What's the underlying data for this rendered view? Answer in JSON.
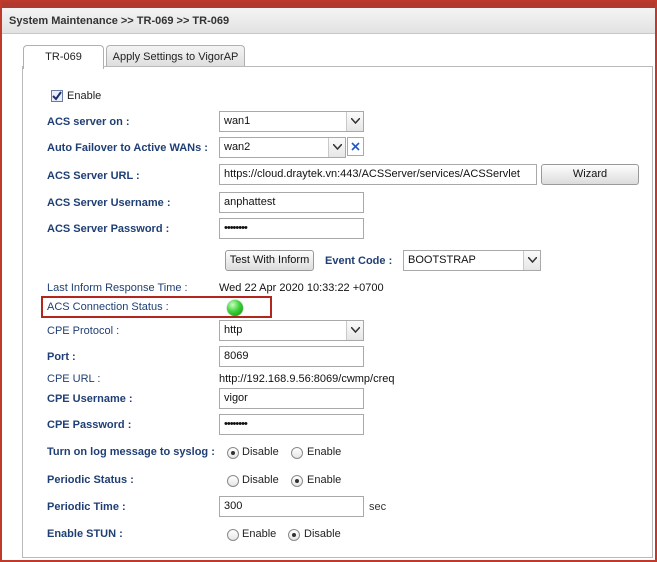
{
  "header": {
    "breadcrumb": "System Maintenance >> TR-069 >> TR-069"
  },
  "tabs": [
    "TR-069",
    "Apply Settings to VigorAP"
  ],
  "enable": {
    "label": "Enable",
    "checked": true
  },
  "acs_server_on": {
    "label": "ACS server on :",
    "value": "wan1"
  },
  "auto_failover": {
    "label": "Auto Failover to Active WANs :",
    "value": "wan2"
  },
  "acs_url": {
    "label": "ACS Server URL :",
    "value": "https://cloud.draytek.vn:443/ACSServer/services/ACSServlet",
    "wizard": "Wizard"
  },
  "acs_username": {
    "label": "ACS Server Username :",
    "value": "anphattest"
  },
  "acs_password": {
    "label": "ACS Server Password :",
    "value": "••••••••"
  },
  "test_inform": {
    "label": "Test With Inform"
  },
  "event_code": {
    "label": "Event Code :",
    "value": "BOOTSTRAP"
  },
  "last_inform": {
    "label": "Last Inform Response Time :",
    "value": "Wed 22 Apr 2020 10:33:22 +0700"
  },
  "acs_conn_status": {
    "label": "ACS Connection Status :",
    "status_color": "#3ed23a"
  },
  "cpe_protocol": {
    "label": "CPE Protocol :",
    "value": "http"
  },
  "port": {
    "label": "Port :",
    "value": "8069"
  },
  "cpe_url": {
    "label": "CPE URL :",
    "value": "http://192.168.9.56:8069/cwmp/creq"
  },
  "cpe_username": {
    "label": "CPE Username :",
    "value": "vigor"
  },
  "cpe_password": {
    "label": "CPE Password :",
    "value": "••••••••"
  },
  "syslog": {
    "label": "Turn on log message to syslog :",
    "opt1": "Disable",
    "opt2": "Enable",
    "selected": "Disable"
  },
  "periodic_status": {
    "label": "Periodic Status :",
    "opt1": "Disable",
    "opt2": "Enable",
    "selected": "Enable"
  },
  "periodic_time": {
    "label": "Periodic Time :",
    "value": "300",
    "unit": "sec"
  },
  "stun": {
    "label": "Enable STUN :",
    "opt1": "Enable",
    "opt2": "Disable",
    "selected": "Disable"
  }
}
